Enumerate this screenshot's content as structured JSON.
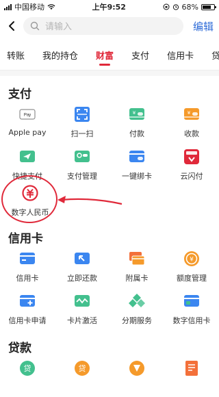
{
  "status_bar": {
    "carrier": "中国移动",
    "time": "上午9:52",
    "battery": "68%"
  },
  "search": {
    "placeholder": "请输入"
  },
  "header": {
    "edit_label": "编辑"
  },
  "tabs": [
    {
      "label": "转账"
    },
    {
      "label": "我的持仓"
    },
    {
      "label": "财富",
      "active": true
    },
    {
      "label": "支付"
    },
    {
      "label": "信用卡"
    },
    {
      "label": "贷"
    }
  ],
  "sections": {
    "pay": {
      "title": "支付",
      "items": [
        {
          "label": "Apple pay",
          "icon": "apple-pay-card-icon"
        },
        {
          "label": "扫一扫",
          "icon": "scan-icon"
        },
        {
          "label": "付款",
          "icon": "payment-card-icon"
        },
        {
          "label": "收款",
          "icon": "receive-money-icon"
        },
        {
          "label": "快捷支付",
          "icon": "quick-pay-icon"
        },
        {
          "label": "支付管理",
          "icon": "pay-management-icon"
        },
        {
          "label": "一键绑卡",
          "icon": "bind-card-icon"
        },
        {
          "label": "云闪付",
          "icon": "cloud-quickpass-icon"
        }
      ],
      "ecny": {
        "label": "数字人民币",
        "icon": "digital-rmb-icon"
      }
    },
    "credit": {
      "title": "信用卡",
      "items": [
        {
          "label": "信用卡",
          "icon": "credit-card-icon"
        },
        {
          "label": "立即还款",
          "icon": "repay-icon"
        },
        {
          "label": "附属卡",
          "icon": "supplementary-card-icon"
        },
        {
          "label": "额度管理",
          "icon": "limit-management-icon"
        },
        {
          "label": "信用卡申请",
          "icon": "card-apply-icon"
        },
        {
          "label": "卡片激活",
          "icon": "card-activate-icon"
        },
        {
          "label": "分期服务",
          "icon": "installment-icon"
        },
        {
          "label": "数字信用卡",
          "icon": "digital-credit-card-icon"
        }
      ]
    },
    "loan": {
      "title": "贷款",
      "items": [
        {
          "label": "",
          "icon": "loan-green-icon"
        },
        {
          "label": "",
          "icon": "loan-orange-icon"
        },
        {
          "label": "",
          "icon": "loan-shield-icon"
        },
        {
          "label": "",
          "icon": "loan-document-icon"
        }
      ]
    }
  }
}
